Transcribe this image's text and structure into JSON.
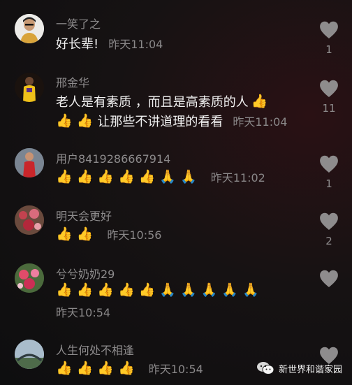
{
  "comments": [
    {
      "username": "一笑了之",
      "content": "好长辈!",
      "time": "昨天11:04",
      "likes": "1"
    },
    {
      "username": "邢金华",
      "content_line1": "老人是有素质 ，而且是高素质的人",
      "content_line2": "让那些不讲道理的看看",
      "time": "昨天11:04",
      "likes": "11"
    },
    {
      "username": "用户8419286667914",
      "time": "昨天11:02",
      "likes": "1"
    },
    {
      "username": "明天会更好",
      "time": "昨天10:56",
      "likes": "2"
    },
    {
      "username": "兮兮奶奶29",
      "time": "昨天10:54",
      "likes": ""
    },
    {
      "username": "人生何处不相逢",
      "time": "昨天10:54",
      "likes": ""
    }
  ],
  "watermark": {
    "text": "新世界和谐家园"
  },
  "colors": {
    "background": "#121213",
    "username": "#8e8c8d",
    "content": "#f1f1f1",
    "heart": "#8e8c8d"
  }
}
